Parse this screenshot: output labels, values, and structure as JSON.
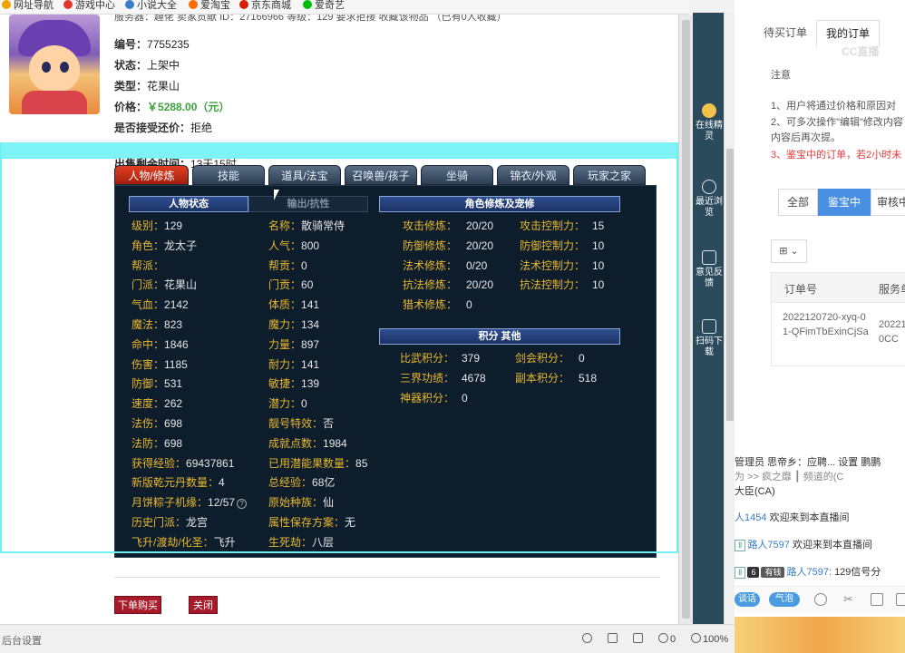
{
  "bookmarks": [
    "网址导航",
    "游戏中心",
    "小说大全",
    "爱淘宝",
    "京东商城",
    "爱奇艺"
  ],
  "listing": {
    "top_row": "服务器：趣佬   卖家贡献   ID：27166966   等级：129   要求拒接   收藏该物品   （已有0人收藏）",
    "id_label": "编号：",
    "id_value": "7755235",
    "status_label": "状态：",
    "status_value": "上架中",
    "type_label": "类型：",
    "type_value": "花果山",
    "price_label": "价格：",
    "price_value": "￥5288.00（元）",
    "counter_label": "是否接受还价：",
    "counter_value": "拒绝",
    "remain_label": "出售剩余时间：",
    "remain_value": "13天15时"
  },
  "tabs": [
    "人物/修炼",
    "技能",
    "道具/法宝",
    "召唤兽/孩子",
    "坐骑",
    "锦衣/外观",
    "玩家之家"
  ],
  "sections": {
    "char_status": "人物状态",
    "out_resist": "输出/抗性",
    "cultivation": "角色修炼及宠修",
    "points": "积分 其他"
  },
  "col1": [
    {
      "label": "级别：",
      "value": "129"
    },
    {
      "label": "角色：",
      "value": "龙太子"
    },
    {
      "label": "帮派：",
      "value": ""
    },
    {
      "label": "门派：",
      "value": "花果山"
    },
    {
      "label": "气血：",
      "value": "2142"
    },
    {
      "label": "魔法：",
      "value": "823"
    },
    {
      "label": "命中：",
      "value": "1846"
    },
    {
      "label": "伤害：",
      "value": "1185"
    },
    {
      "label": "防御：",
      "value": "531"
    },
    {
      "label": "速度：",
      "value": "262"
    },
    {
      "label": "法伤：",
      "value": "698"
    },
    {
      "label": "法防：",
      "value": "698"
    },
    {
      "label": "获得经验：",
      "value": "69437861"
    },
    {
      "label": "新版乾元丹数量：",
      "value": "4"
    },
    {
      "label": "月饼粽子机缘：",
      "value": "12/57"
    },
    {
      "label": "历史门派：",
      "value": "龙宫"
    },
    {
      "label": "飞升/渡劫/化圣：",
      "value": "飞升"
    }
  ],
  "col2": [
    {
      "label": "名称：",
      "value": "散骑常侍"
    },
    {
      "label": "人气：",
      "value": "800"
    },
    {
      "label": "帮贡：",
      "value": "0"
    },
    {
      "label": "门贡：",
      "value": "60"
    },
    {
      "label": "体质：",
      "value": "141"
    },
    {
      "label": "魔力：",
      "value": "134"
    },
    {
      "label": "力量：",
      "value": "897"
    },
    {
      "label": "耐力：",
      "value": "141"
    },
    {
      "label": "敏捷：",
      "value": "139"
    },
    {
      "label": "潜力：",
      "value": "0"
    },
    {
      "label": "靓号特效：",
      "value": "否"
    },
    {
      "label": "成就点数：",
      "value": "1984"
    },
    {
      "label": "已用潜能果数量：",
      "value": "85"
    },
    {
      "label": "总经验：",
      "value": "68亿"
    },
    {
      "label": "原始种族：",
      "value": "仙"
    },
    {
      "label": "属性保存方案：",
      "value": "无"
    },
    {
      "label": "生死劫：",
      "value": "八层"
    }
  ],
  "cult_left": [
    {
      "label": "攻击修炼：",
      "value": "20/20"
    },
    {
      "label": "防御修炼：",
      "value": "20/20"
    },
    {
      "label": "法术修炼：",
      "value": "0/20"
    },
    {
      "label": "抗法修炼：",
      "value": "20/20"
    },
    {
      "label": "猎术修炼：",
      "value": "0"
    }
  ],
  "cult_right": [
    {
      "label": "攻击控制力：",
      "value": "15"
    },
    {
      "label": "防御控制力：",
      "value": "10"
    },
    {
      "label": "法术控制力：",
      "value": "10"
    },
    {
      "label": "抗法控制力：",
      "value": "10"
    }
  ],
  "points_left": [
    {
      "label": "比武积分：",
      "value": "379"
    },
    {
      "label": "三界功绩：",
      "value": "4678"
    },
    {
      "label": "神器积分：",
      "value": "0"
    }
  ],
  "points_right": [
    {
      "label": "剑会积分：",
      "value": "0"
    },
    {
      "label": "副本积分：",
      "value": "518"
    }
  ],
  "buttons": {
    "buy": "下单购买",
    "close": "关闭"
  },
  "sidebar": [
    {
      "label": "在线精灵"
    },
    {
      "label": "最近浏览"
    },
    {
      "label": "意见反馈"
    },
    {
      "label": "扫码下载"
    }
  ],
  "order_panel": {
    "tab_pending": "待买订单",
    "tab_mine": "我的订单",
    "logo": "CC直播",
    "note_title": "注意",
    "note1": "1、用户将通过价格和原因对",
    "note2": "2、可多次操作\"编辑\"修改内容",
    "note2b": "内容后再次提。",
    "note3": "3、鉴宝中的订单，若2小时未",
    "filters": [
      "全部",
      "鉴宝中",
      "审核中"
    ],
    "grid_toggle": "⊞ ⌄",
    "col_order": "订单号",
    "col_service": "服务单",
    "order_no": "2022120720-xyq-01-QFimTbExinCjSa",
    "service_no": "2022120CC"
  },
  "chat": {
    "line1": "管理员 思帝乡：应聘... 设置 鹏鹏",
    "line2": "为  >>   疯之靡 ┃ 频道的(C",
    "line3": "大臣(CA)",
    "line4_name": "人1454",
    "line4_msg": "欢迎来到本直播间",
    "line5_name": "路人7597",
    "line5_msg": "欢迎来到本直播间",
    "line6_lvl": "6",
    "line6_tag": "有钱",
    "line6_name": "路人7597:",
    "line6_msg": "129信号分",
    "bar_pill1": "谈话",
    "bar_pill2": "气泡"
  },
  "statusbar": {
    "left": "后台设置",
    "count": "0",
    "zoom": "100%"
  }
}
